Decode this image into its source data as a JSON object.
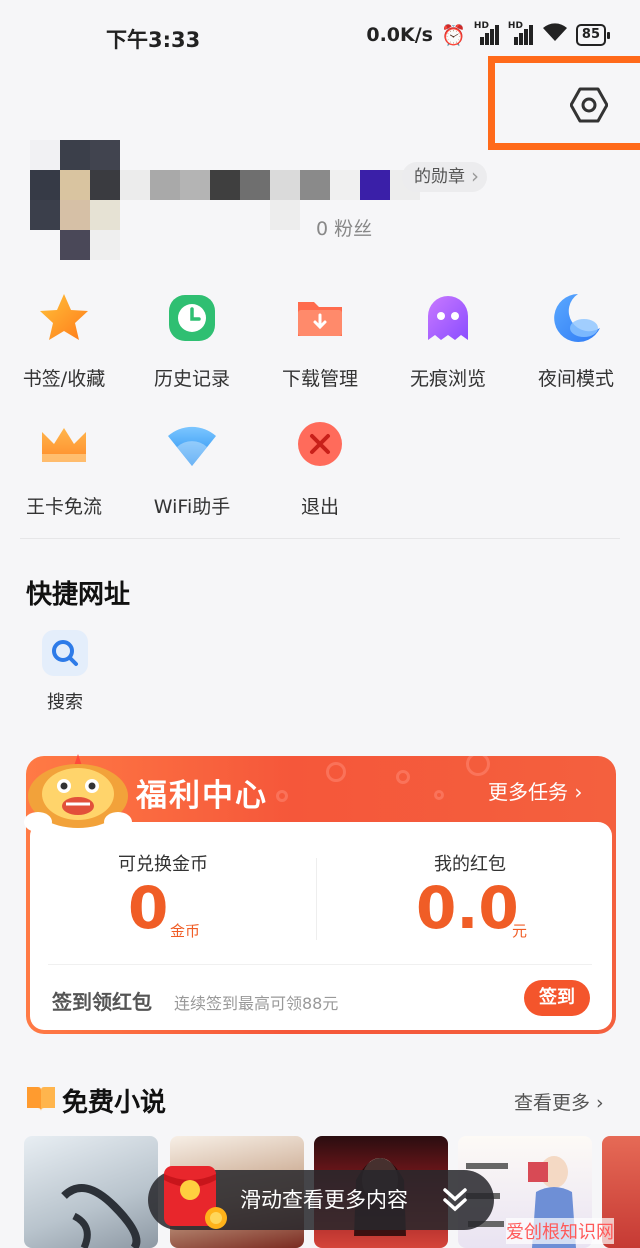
{
  "status_bar": {
    "time": "下午3:33",
    "net_speed": "0.0K/s",
    "battery": "85"
  },
  "profile": {
    "badge_label": "的勋章",
    "fans_label": "0 粉丝"
  },
  "menu": [
    {
      "label": "书签/收藏",
      "icon": "star-icon"
    },
    {
      "label": "历史记录",
      "icon": "clock-icon"
    },
    {
      "label": "下载管理",
      "icon": "download-folder-icon"
    },
    {
      "label": "无痕浏览",
      "icon": "ghost-icon"
    },
    {
      "label": "夜间模式",
      "icon": "moon-icon"
    },
    {
      "label": "王卡免流",
      "icon": "crown-icon"
    },
    {
      "label": "WiFi助手",
      "icon": "wifi-icon"
    },
    {
      "label": "退出",
      "icon": "close-icon"
    }
  ],
  "quick_links": {
    "title": "快捷网址",
    "items": [
      {
        "label": "搜索",
        "icon": "search-icon"
      }
    ]
  },
  "welfare": {
    "title": "福利中心",
    "more_label": "更多任务 ›",
    "coins_label": "可兑换金币",
    "coins_value": "0",
    "coins_unit": "金币",
    "redpack_label": "我的红包",
    "redpack_value": "0.0",
    "redpack_unit": "元",
    "signin_title": "签到领红包",
    "signin_subtitle": "连续签到最高可领88元",
    "signin_button": "签到"
  },
  "novels": {
    "title": "免费小说",
    "more_label": "查看更多 ›"
  },
  "floating_banner": {
    "text": "滑动查看更多内容"
  },
  "watermark": "爱创根知识网",
  "colors": {
    "accent": "#f05d26",
    "highlight_box": "#ff6a1a"
  }
}
